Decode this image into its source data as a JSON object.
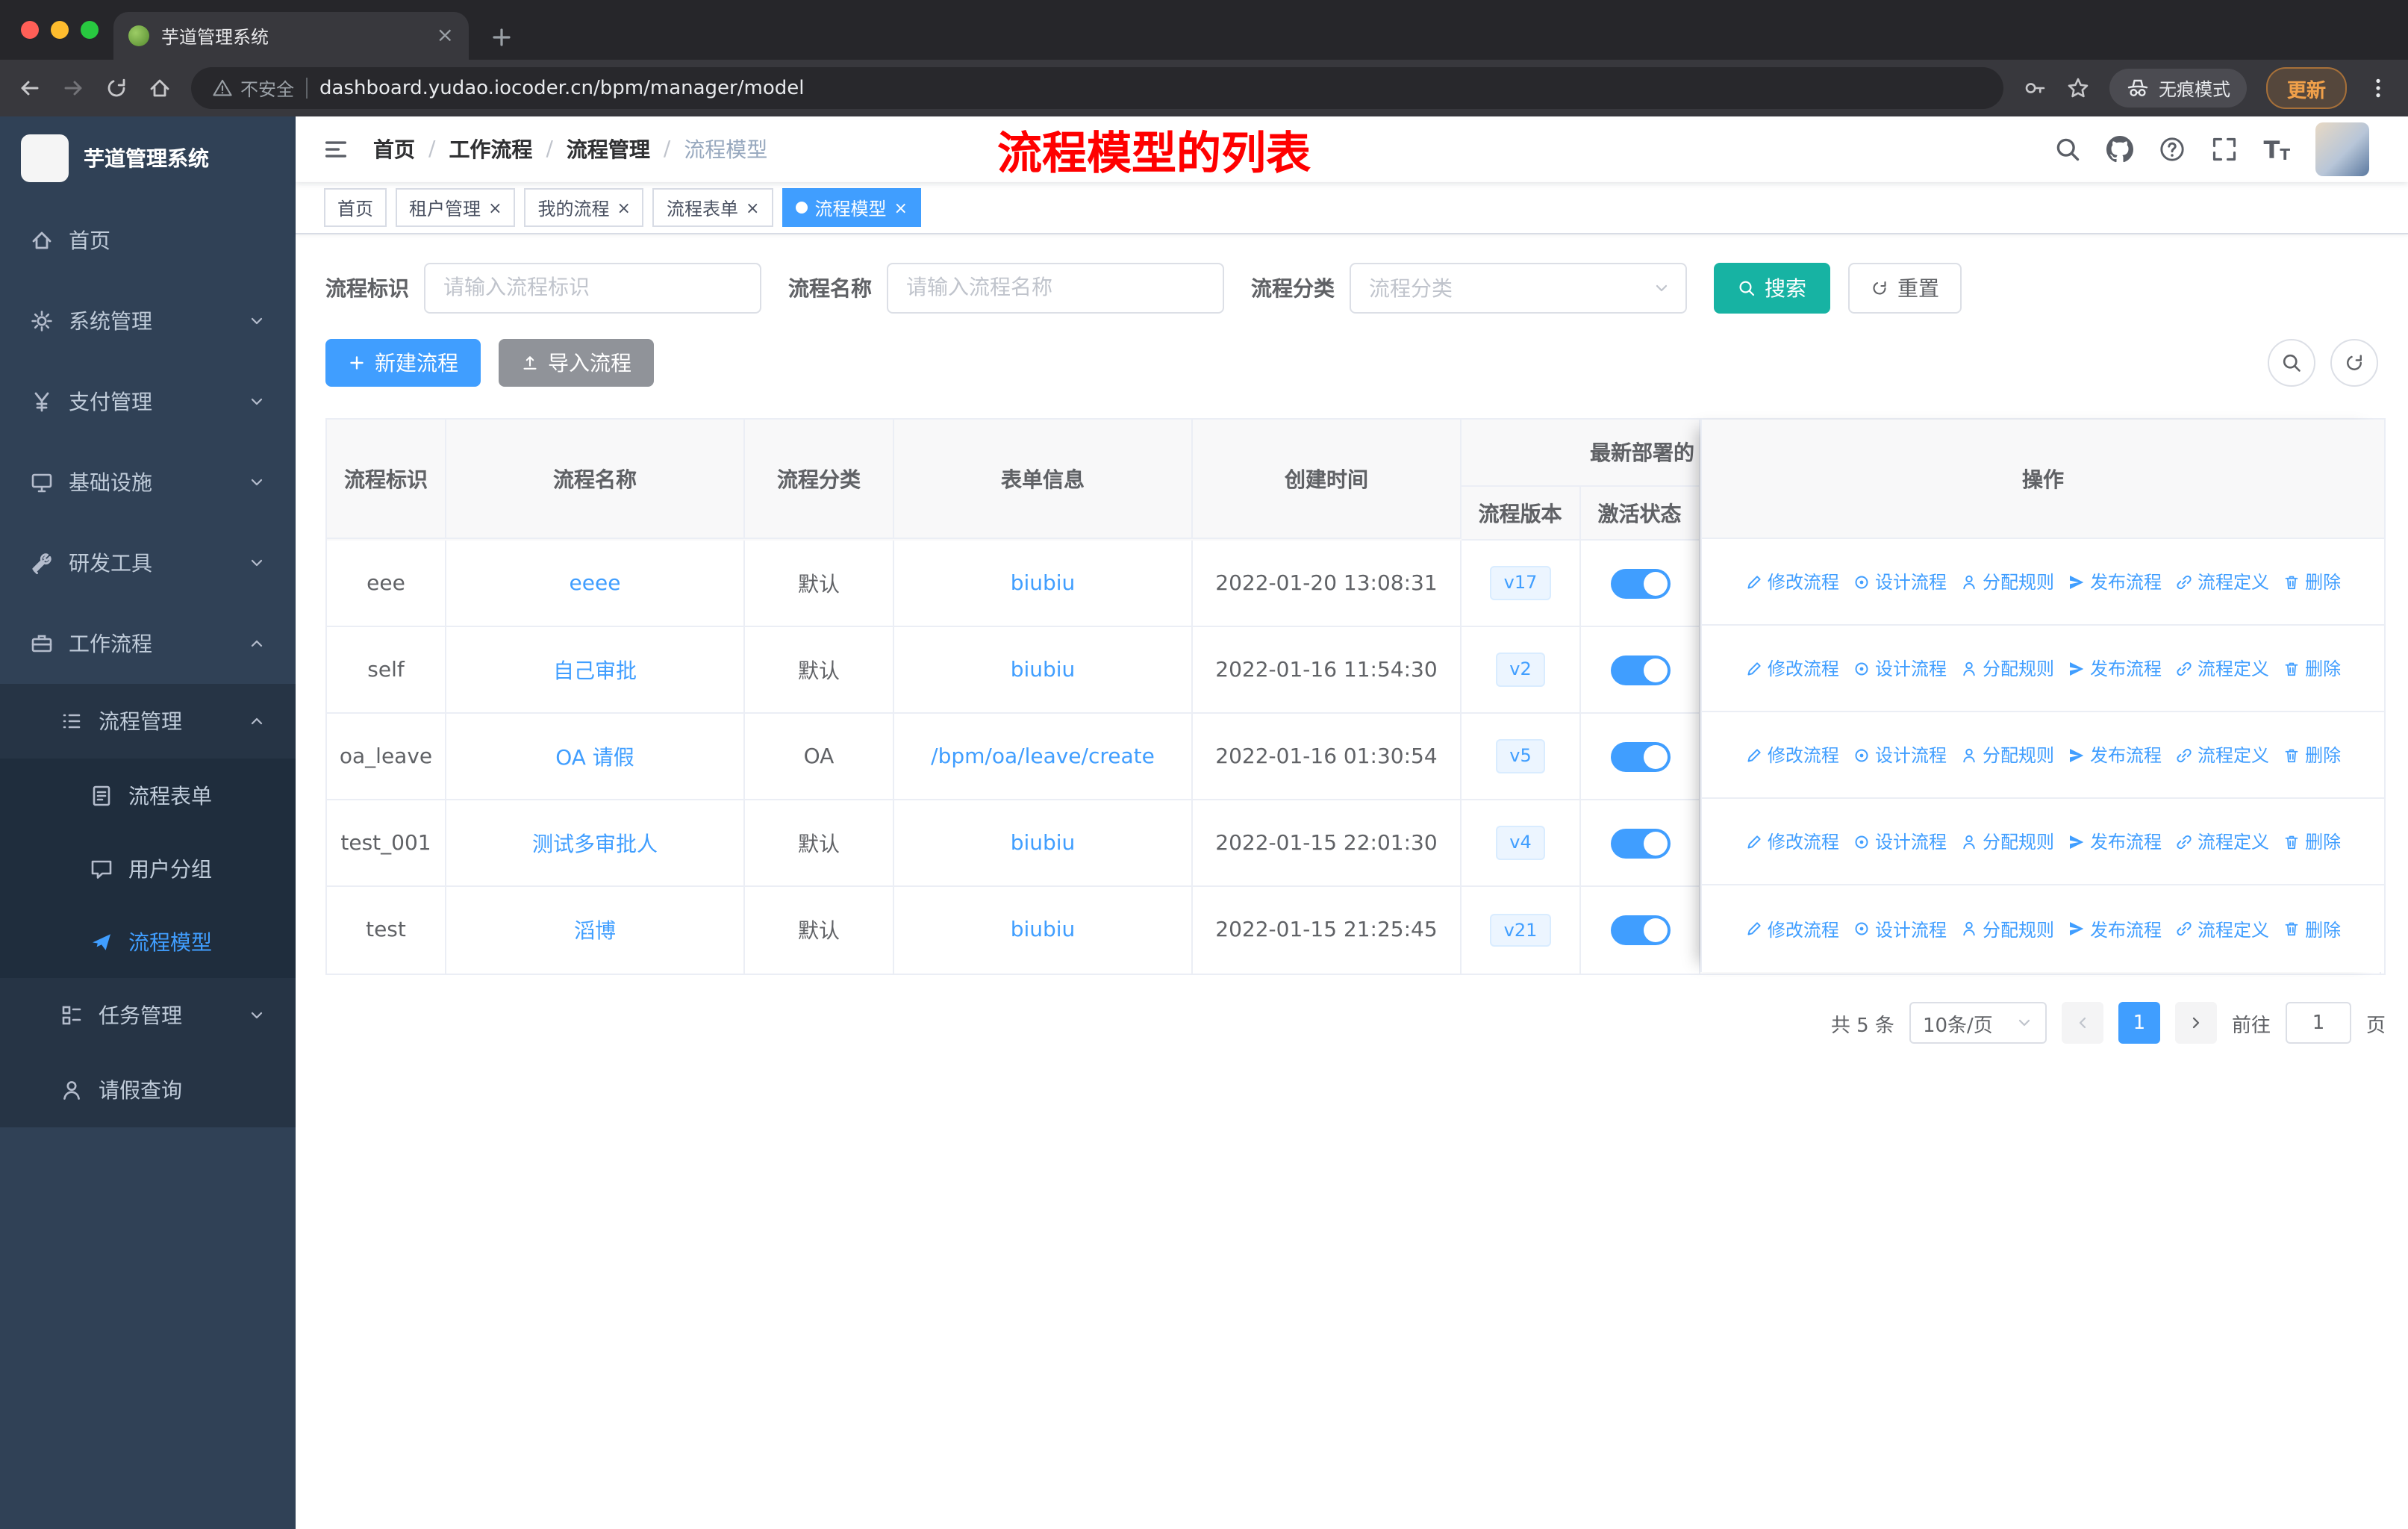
{
  "colors": {
    "accent": "#409eff",
    "search_button": "#17b3a3",
    "annotation": "#ff0000",
    "sidebar_bg": "#304156"
  },
  "browser": {
    "tab_title": "芋道管理系统",
    "security_label": "不安全",
    "url": "dashboard.yudao.iocoder.cn/bpm/manager/model",
    "incognito_label": "无痕模式",
    "update_label": "更新"
  },
  "sidebar": {
    "logo_title": "芋道管理系统",
    "items": [
      {
        "label": "首页"
      },
      {
        "label": "系统管理"
      },
      {
        "label": "支付管理"
      },
      {
        "label": "基础设施"
      },
      {
        "label": "研发工具"
      },
      {
        "label": "工作流程"
      }
    ],
    "workflow_children": [
      {
        "label": "流程管理"
      },
      {
        "label": "任务管理"
      },
      {
        "label": "请假查询"
      }
    ],
    "process_children": [
      {
        "label": "流程表单"
      },
      {
        "label": "用户分组"
      },
      {
        "label": "流程模型"
      }
    ]
  },
  "header": {
    "breadcrumb": [
      "首页",
      "工作流程",
      "流程管理",
      "流程模型"
    ],
    "separator": "/",
    "annotation": "流程模型的列表"
  },
  "tags": [
    {
      "label": "首页"
    },
    {
      "label": "租户管理"
    },
    {
      "label": "我的流程"
    },
    {
      "label": "流程表单"
    },
    {
      "label": "流程模型"
    }
  ],
  "filters": {
    "key_label": "流程标识",
    "key_placeholder": "请输入流程标识",
    "name_label": "流程名称",
    "name_placeholder": "请输入流程名称",
    "category_label": "流程分类",
    "category_placeholder": "流程分类",
    "search_label": "搜索",
    "reset_label": "重置"
  },
  "toolbar": {
    "create_label": "新建流程",
    "import_label": "导入流程"
  },
  "table": {
    "headers": {
      "key": "流程标识",
      "name": "流程名称",
      "category": "流程分类",
      "form": "表单信息",
      "created": "创建时间",
      "deploy_group": "最新部署的",
      "version": "流程版本",
      "active": "激活状态",
      "actions": "操作"
    },
    "rows": [
      {
        "key": "eee",
        "name": "eeee",
        "category": "默认",
        "form": "biubiu",
        "created": "2022-01-20 13:08:31",
        "version": "v17",
        "active": true
      },
      {
        "key": "self",
        "name": "自己审批",
        "category": "默认",
        "form": "biubiu",
        "created": "2022-01-16 11:54:30",
        "version": "v2",
        "active": true
      },
      {
        "key": "oa_leave",
        "name": "OA 请假",
        "category": "OA",
        "form": "/bpm/oa/leave/create",
        "created": "2022-01-16 01:30:54",
        "version": "v5",
        "active": true
      },
      {
        "key": "test_001",
        "name": "测试多审批人",
        "category": "默认",
        "form": "biubiu",
        "created": "2022-01-15 22:01:30",
        "version": "v4",
        "active": true
      },
      {
        "key": "test",
        "name": "滔博",
        "category": "默认",
        "form": "biubiu",
        "created": "2022-01-15 21:25:45",
        "version": "v21",
        "active": true
      }
    ],
    "row_actions": [
      "修改流程",
      "设计流程",
      "分配规则",
      "发布流程",
      "流程定义",
      "删除"
    ]
  },
  "pagination": {
    "total": "共 5 条",
    "page_size": "10条/页",
    "current_page": "1",
    "goto_label": "前往",
    "goto_value": "1",
    "unit_label": "页"
  }
}
